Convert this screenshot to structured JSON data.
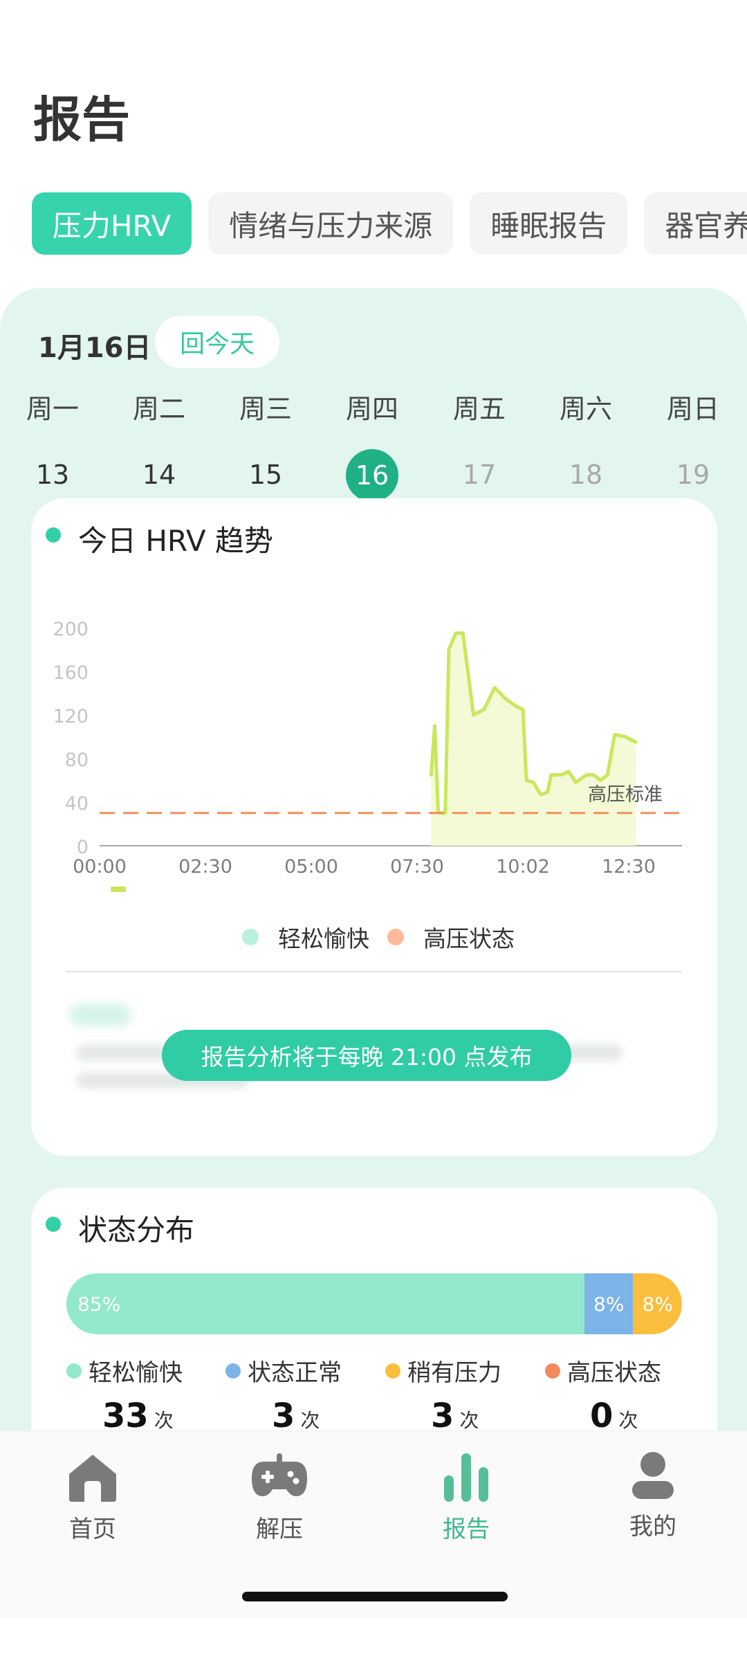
{
  "header": {
    "title": "报告"
  },
  "tabs": [
    {
      "label": "压力HRV",
      "active": true
    },
    {
      "label": "情绪与压力来源",
      "active": false
    },
    {
      "label": "睡眠报告",
      "active": false
    },
    {
      "label": "器官养",
      "active": false
    }
  ],
  "date_bar": {
    "date": "1月16日",
    "today_button": "回今天"
  },
  "week": [
    {
      "name": "周一",
      "day": "13",
      "state": "past"
    },
    {
      "name": "周二",
      "day": "14",
      "state": "past"
    },
    {
      "name": "周三",
      "day": "15",
      "state": "past"
    },
    {
      "name": "周四",
      "day": "16",
      "state": "selected"
    },
    {
      "name": "周五",
      "day": "17",
      "state": "future"
    },
    {
      "name": "周六",
      "day": "18",
      "state": "future"
    },
    {
      "name": "周日",
      "day": "19",
      "state": "future"
    }
  ],
  "hrv_card": {
    "title": "今日 HRV 趋势",
    "threshold_label": "高压标准",
    "legend": [
      {
        "label": "轻松愉快",
        "color": "#b9f0dd"
      },
      {
        "label": "高压状态",
        "color": "#ffb99a"
      }
    ],
    "report_notice": "报告分析将于每晚 21:00 点发布"
  },
  "chart_data": {
    "type": "area",
    "title": "今日 HRV 趋势",
    "xlabel": "",
    "ylabel": "",
    "ylim": [
      0,
      200
    ],
    "yticks": [
      "200",
      "160",
      "120",
      "80",
      "40",
      "0"
    ],
    "xticks": [
      "00:00",
      "02:30",
      "05:00",
      "07:30",
      "10:02",
      "12:30"
    ],
    "xlim_minutes": [
      0,
      900
    ],
    "threshold": {
      "value": 30,
      "label": "高压标准",
      "color": "#f0905a"
    },
    "series": [
      {
        "color": "#c8e85c",
        "x_minutes": [
          470,
          475,
          480,
          490,
          495,
          505,
          515,
          530,
          545,
          560,
          575,
          590,
          600,
          605,
          615,
          625,
          635,
          640,
          655,
          665,
          675,
          690,
          700,
          710,
          720,
          730,
          745,
          760
        ],
        "y": [
          65,
          110,
          30,
          30,
          180,
          195,
          195,
          120,
          125,
          145,
          135,
          128,
          125,
          60,
          58,
          47,
          49,
          65,
          65,
          68,
          58,
          65,
          65,
          60,
          65,
          102,
          100,
          95
        ]
      }
    ],
    "grid": false
  },
  "distribution": {
    "title": "状态分布",
    "segments": [
      {
        "label": "85%",
        "value": 85,
        "color": "#93e8cb"
      },
      {
        "label": "8%",
        "value": 8,
        "color": "#7cb3e8"
      },
      {
        "label": "8%",
        "value": 8,
        "color": "#fbbd3c"
      }
    ],
    "statuses": [
      {
        "label": "轻松愉快",
        "color": "#93e8cb",
        "count": "33",
        "unit": "次"
      },
      {
        "label": "状态正常",
        "color": "#7cb3e8",
        "count": "3",
        "unit": "次"
      },
      {
        "label": "稍有压力",
        "color": "#fbbd3c",
        "count": "3",
        "unit": "次"
      },
      {
        "label": "高压状态",
        "color": "#f28a5e",
        "count": "0",
        "unit": "次"
      }
    ]
  },
  "nav": [
    {
      "label": "首页",
      "icon": "home-icon"
    },
    {
      "label": "解压",
      "icon": "gamepad-icon"
    },
    {
      "label": "报告",
      "icon": "bar-chart-icon",
      "active": true
    },
    {
      "label": "我的",
      "icon": "user-icon"
    }
  ]
}
